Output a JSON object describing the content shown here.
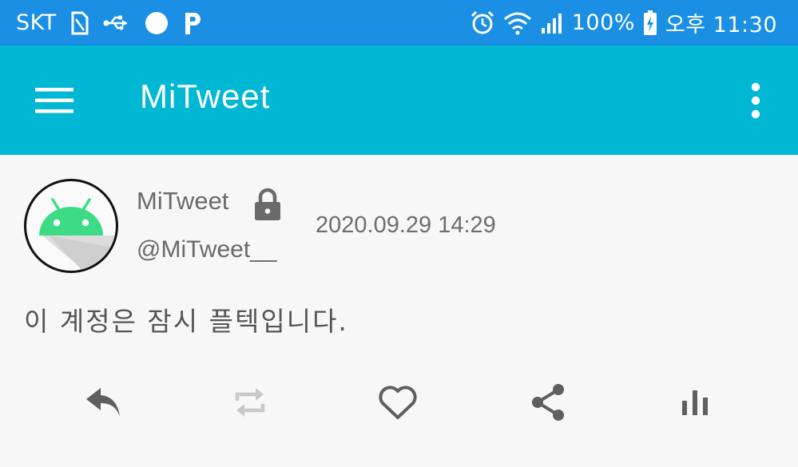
{
  "status_bar": {
    "carrier": "SKT",
    "battery": "100%",
    "time": "오후 11:30",
    "icons": [
      "sim-card-icon",
      "usb-icon",
      "circle-notification-icon",
      "p-notification-icon",
      "alarm-icon",
      "wifi-icon",
      "signal-icon",
      "battery-charging-icon"
    ]
  },
  "app_bar": {
    "title": "MiTweet",
    "icons": [
      "hamburger-menu-icon",
      "overflow-menu-icon"
    ]
  },
  "tweet": {
    "display_name": "MiTweet",
    "handle": "@MiTweet__",
    "timestamp": "2020.09.29 14:29",
    "text": "이 계정은 잠시 플텍입니다.",
    "protected": true,
    "actions": [
      "reply-icon",
      "retweet-icon",
      "like-icon",
      "share-icon",
      "stats-icon"
    ]
  },
  "colors": {
    "status_bar": "#1a8fe3",
    "app_bar": "#00b7d4",
    "background": "#f7f7f7",
    "android_green": "#3ddc84"
  }
}
